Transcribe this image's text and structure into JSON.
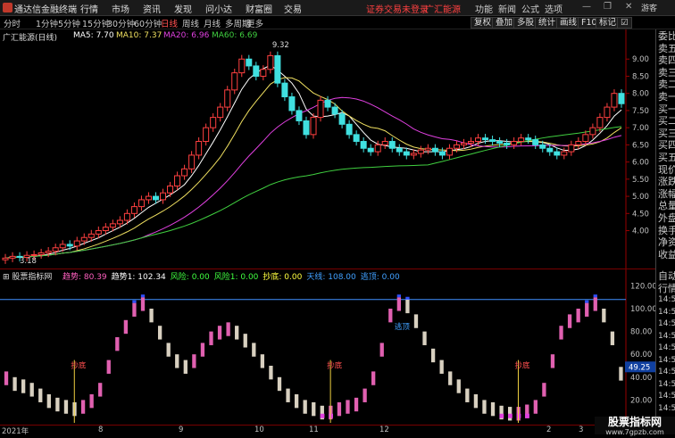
{
  "app": {
    "name": "通达信金融终端",
    "menu": [
      "行情",
      "市场",
      "资讯",
      "发现",
      "问小达",
      "财富圈",
      "交易"
    ],
    "security_warning": "证券交易未登录",
    "broker": "广汇能源",
    "right_menu": [
      "功能",
      "新闻",
      "公式",
      "选项"
    ],
    "right_sub": "游客"
  },
  "periods": [
    "分时",
    "1分钟",
    "5分钟",
    "15分钟",
    "30分钟",
    "60分钟",
    "日线",
    "周线",
    "月线",
    "多周期",
    "更多"
  ],
  "active_period": "日线",
  "toolbar": [
    "复权",
    "叠加",
    "多股",
    "统计",
    "画线",
    "F10",
    "标记",
    "☑"
  ],
  "chart_data": [
    {
      "type": "candlestick",
      "stock_label": "广汇能源(日线)",
      "ma": [
        {
          "name": "MA5",
          "value": "7.70",
          "color": "#ffffff"
        },
        {
          "name": "MA10",
          "value": "7.37",
          "color": "#f0e060"
        },
        {
          "name": "MA20",
          "value": "6.96",
          "color": "#e040e0"
        },
        {
          "name": "MA60",
          "value": "6.69",
          "color": "#40d040"
        }
      ],
      "y_ticks": [
        "9.00",
        "8.50",
        "8.00",
        "7.50",
        "7.00",
        "6.50",
        "6.00",
        "5.50",
        "5.00",
        "4.50",
        "4.00"
      ],
      "ylim": [
        3.0,
        9.5
      ],
      "high_label": "9.32",
      "low_label": "3.18",
      "close": [
        3.2,
        3.25,
        3.22,
        3.28,
        3.3,
        3.35,
        3.4,
        3.5,
        3.6,
        3.55,
        3.7,
        3.8,
        3.9,
        4.0,
        4.1,
        4.2,
        4.3,
        4.5,
        4.7,
        4.9,
        5.0,
        4.9,
        5.1,
        5.3,
        5.6,
        5.8,
        6.2,
        6.6,
        7.0,
        7.3,
        7.6,
        8.1,
        8.6,
        9.0,
        8.8,
        8.5,
        8.7,
        9.1,
        8.3,
        7.9,
        7.5,
        7.2,
        6.8,
        7.3,
        7.8,
        7.6,
        7.4,
        7.1,
        6.8,
        6.6,
        6.4,
        6.3,
        6.5,
        6.6,
        6.4,
        6.3,
        6.2,
        6.25,
        6.35,
        6.4,
        6.3,
        6.2,
        6.4,
        6.5,
        6.55,
        6.6,
        6.7,
        6.65,
        6.6,
        6.55,
        6.5,
        6.6,
        6.7,
        6.65,
        6.5,
        6.4,
        6.3,
        6.2,
        6.3,
        6.5,
        6.6,
        6.8,
        7.0,
        7.3,
        7.6,
        8.0,
        7.7
      ]
    },
    {
      "type": "bar",
      "indicator_name": "股票指标网",
      "legend": [
        {
          "name": "趋势",
          "value": "80.39",
          "color": "#ff60c0"
        },
        {
          "name": "趋势1",
          "value": "102.34",
          "color": "#ffffff"
        },
        {
          "name": "风险",
          "value": "0.00",
          "color": "#40ff40"
        },
        {
          "name": "风险1",
          "value": "0.00",
          "color": "#40ff40"
        },
        {
          "name": "抄底",
          "value": "0.00",
          "color": "#ffff40"
        },
        {
          "name": "天线",
          "value": "108.00",
          "color": "#40a0ff"
        },
        {
          "name": "逃顶",
          "value": "0.00",
          "color": "#40a0ff"
        }
      ],
      "y_ticks": [
        "120.00",
        "100.00",
        "80.00",
        "60.00",
        "40.00",
        "20.00"
      ],
      "ylim": [
        0,
        125
      ],
      "antenna_level": 108,
      "current_value_label": "49.25",
      "values": [
        45,
        40,
        38,
        35,
        30,
        25,
        22,
        20,
        18,
        20,
        25,
        35,
        55,
        75,
        90,
        105,
        110,
        100,
        85,
        70,
        60,
        55,
        60,
        70,
        80,
        85,
        88,
        85,
        78,
        70,
        60,
        50,
        40,
        30,
        25,
        20,
        18,
        15,
        15,
        18,
        20,
        22,
        30,
        45,
        70,
        100,
        110,
        108,
        95,
        80,
        65,
        55,
        45,
        38,
        30,
        25,
        20,
        18,
        15,
        14,
        14,
        16,
        20,
        35,
        60,
        85,
        95,
        100,
        105,
        110,
        100,
        80,
        49
      ],
      "bottom_labels": [
        "抄底",
        "抄底",
        "抄底",
        "抄底",
        "抄底"
      ],
      "escape_label": "逃顶"
    }
  ],
  "x_axis": [
    "2021年",
    "8",
    "9",
    "10",
    "11",
    "12",
    "2",
    "3"
  ],
  "right_panel": [
    "委比",
    "卖五",
    "卖四",
    "卖三",
    "卖二",
    "卖一",
    "买一",
    "买二",
    "买三",
    "买四",
    "买五",
    "现价",
    "涨跌",
    "涨幅",
    "总量",
    "外盘",
    "换手",
    "净资",
    "收益"
  ],
  "right_panel_lower": [
    "自动",
    "行情",
    "14:50",
    "14:50",
    "14:50",
    "14:50",
    "14:50",
    "14:50",
    "14:50",
    "14:50",
    "14:50",
    "14:50"
  ],
  "watermark": {
    "text": "股票指标网",
    "url": "www.7gpzb.com"
  }
}
